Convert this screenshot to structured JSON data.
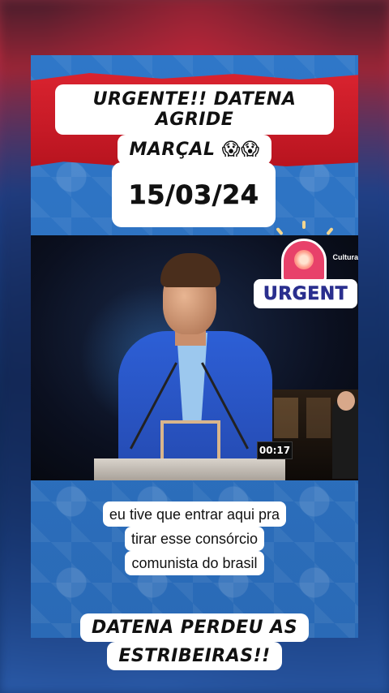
{
  "headline": {
    "line1": "URGENTE!! DATENA AGRIDE",
    "line2": "MARÇAL",
    "emoji": "😱😱"
  },
  "date": "15/03/24",
  "video": {
    "channel_label": "Cultura",
    "sticker_text": "URGENT",
    "timer": "00:17"
  },
  "caption": {
    "line1": "eu tive que entrar aqui pra",
    "line2": "tirar esse consórcio",
    "line3": "comunista do brasil"
  },
  "bottom": {
    "line1": "DATENA PERDEU AS",
    "line2": "ESTRIBEIRAS!!"
  },
  "colors": {
    "banner_red": "#d9232f",
    "card_blue": "#2b6fbf",
    "sticker_text": "#2a2f8e"
  },
  "icons": [
    "siren-icon",
    "scream-emoji"
  ]
}
